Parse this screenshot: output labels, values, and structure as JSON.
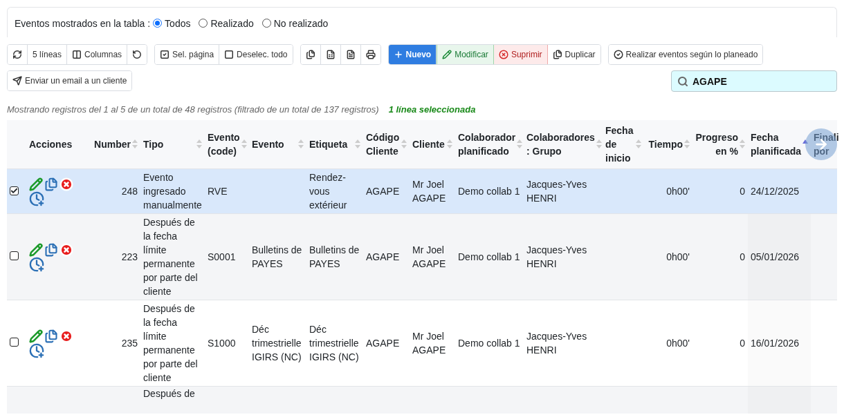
{
  "filter": {
    "label": "Eventos mostrados en la tabla :",
    "options": [
      {
        "label": "Todos",
        "selected": true
      },
      {
        "label": "Realizado",
        "selected": false
      },
      {
        "label": "No realizado",
        "selected": false
      }
    ]
  },
  "toolbar": [
    {
      "buttons": [
        {
          "kind": "icon"
        },
        {
          "kind": "default",
          "label": "5 líneas"
        },
        {
          "kind": "default",
          "label": "Columnas"
        },
        {
          "kind": "icon"
        }
      ]
    },
    {
      "buttons": [
        {
          "kind": "default",
          "label": "Sel. página"
        },
        {
          "kind": "default",
          "label": "Deselec. todo"
        }
      ]
    },
    {
      "buttons": [
        {
          "kind": "icon"
        },
        {
          "kind": "icon"
        },
        {
          "kind": "icon"
        },
        {
          "kind": "icon"
        }
      ]
    },
    {
      "buttons": [
        {
          "kind": "primary",
          "label": "Nuevo"
        },
        {
          "kind": "success",
          "label": "Modificar"
        },
        {
          "kind": "danger",
          "label": "Suprimir"
        },
        {
          "kind": "default",
          "label": "Duplicar"
        }
      ]
    },
    {
      "buttons": [
        {
          "kind": "default",
          "label": "Realizar eventos según lo planeado"
        }
      ]
    },
    {
      "buttons": [
        {
          "kind": "default",
          "label": "Enviar un email a un cliente"
        }
      ]
    }
  ],
  "search": {
    "value": "AGAPE"
  },
  "info": {
    "text": "Mostrando registros del 1 al 5 de un total de 48 registros (filtrado de un total de 137 registros)",
    "selection": "1 línea seleccionada"
  },
  "table": {
    "columns": [
      {
        "sortable": false
      },
      {
        "label": "Acciones",
        "sortable": false
      },
      {
        "label": "Number",
        "sortable": true,
        "sorted": false
      },
      {
        "label": "Tipo",
        "sortable": true,
        "sorted": false
      },
      {
        "label": "Evento (code)",
        "sortable": true,
        "sorted": false
      },
      {
        "label": "Evento",
        "sortable": true,
        "sorted": false
      },
      {
        "label": "Etiqueta",
        "sortable": true,
        "sorted": false
      },
      {
        "label": "Código Cliente",
        "sortable": true,
        "sorted": false
      },
      {
        "label": "Cliente",
        "sortable": true,
        "sorted": false
      },
      {
        "label": "Colaborador planificado",
        "sortable": true,
        "sorted": false
      },
      {
        "label": "Colaboradores : Grupo",
        "sortable": true,
        "sorted": false
      },
      {
        "label": "Fecha de inicio",
        "sortable": true,
        "sorted": false
      },
      {
        "label": "Tiempo",
        "sortable": true,
        "sorted": false
      },
      {
        "label": "Progreso en %",
        "sortable": true,
        "sorted": false
      },
      {
        "label": "Fecha planificada",
        "sortable": true,
        "sorted": true
      },
      {
        "label": "Finali por",
        "sortable": false
      }
    ],
    "rows": [
      {
        "selected": true,
        "cells": [
          "",
          "",
          "248",
          "Evento ingresado manualmente",
          "RVE",
          "",
          "Rendez-vous extérieur",
          "AGAPE",
          "Mr Joel AGAPE",
          "Demo collab 1",
          "Jacques-Yves HENRI",
          "",
          "0h00'",
          "0",
          "24/12/2025"
        ]
      },
      {
        "selected": false,
        "cells": [
          "",
          "",
          "223",
          "Después de la fecha límite permanente por parte del cliente",
          "S0001",
          "Bulletins de PAYES",
          "Bulletins de PAYES",
          "AGAPE",
          "Mr Joel AGAPE",
          "Demo collab 1",
          "Jacques-Yves HENRI",
          "",
          "0h00'",
          "0",
          "05/01/2026"
        ]
      },
      {
        "selected": false,
        "cells": [
          "",
          "",
          "235",
          "Después de la fecha límite permanente por parte del cliente",
          "S1000",
          "Déc trimestrielle IGIRS (NC)",
          "Déc trimestrielle IGIRS (NC)",
          "AGAPE",
          "Mr Joel AGAPE",
          "Demo collab 1",
          "Jacques-Yves HENRI",
          "",
          "0h00'",
          "0",
          "16/01/2026"
        ]
      },
      {
        "cells": [
          "",
          "",
          "",
          "Después de"
        ]
      }
    ]
  }
}
